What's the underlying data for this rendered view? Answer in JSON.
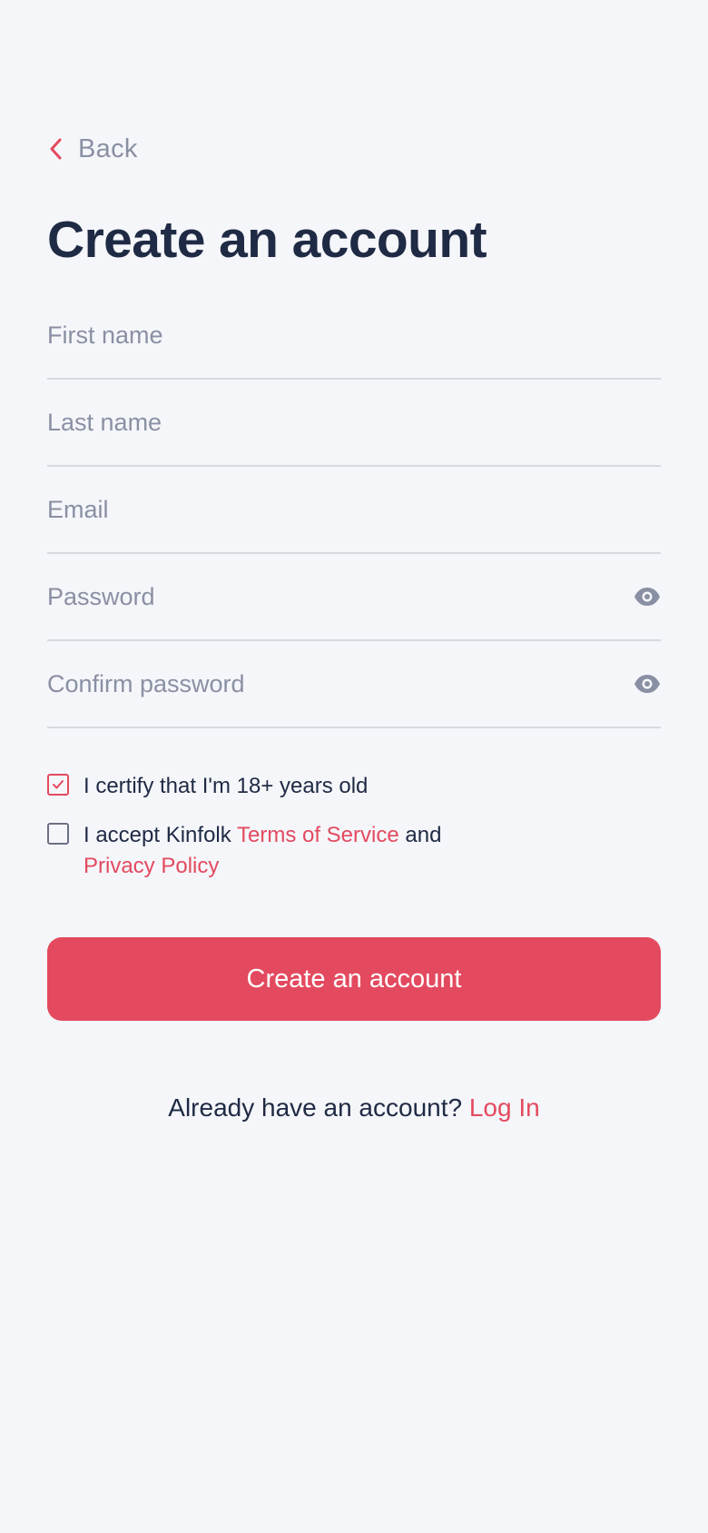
{
  "back": {
    "label": "Back",
    "icon": "chevron-left-icon"
  },
  "title": "Create an account",
  "form": {
    "first_name": {
      "placeholder": "First name",
      "value": ""
    },
    "last_name": {
      "placeholder": "Last name",
      "value": ""
    },
    "email": {
      "placeholder": "Email",
      "value": ""
    },
    "password": {
      "placeholder": "Password",
      "value": "",
      "icon": "eye-icon"
    },
    "confirm_password": {
      "placeholder": "Confirm password",
      "value": "",
      "icon": "eye-icon"
    }
  },
  "checkboxes": {
    "age": {
      "label": "I certify that I'm 18+ years old",
      "checked": true
    },
    "terms": {
      "prefix": "I accept Kinfolk ",
      "terms_link": "Terms of Service",
      "middle": " and",
      "privacy_link": "Privacy Policy",
      "checked": false
    }
  },
  "primary_button": {
    "label": "Create an account"
  },
  "login_prompt": {
    "text": "Already have an account? ",
    "link": "Log In"
  },
  "colors": {
    "accent": "#e34a5f",
    "text_dark": "#1f2a44",
    "text_muted": "#8a90a3",
    "background": "#f5f6fa",
    "divider": "#d6d9e0"
  }
}
